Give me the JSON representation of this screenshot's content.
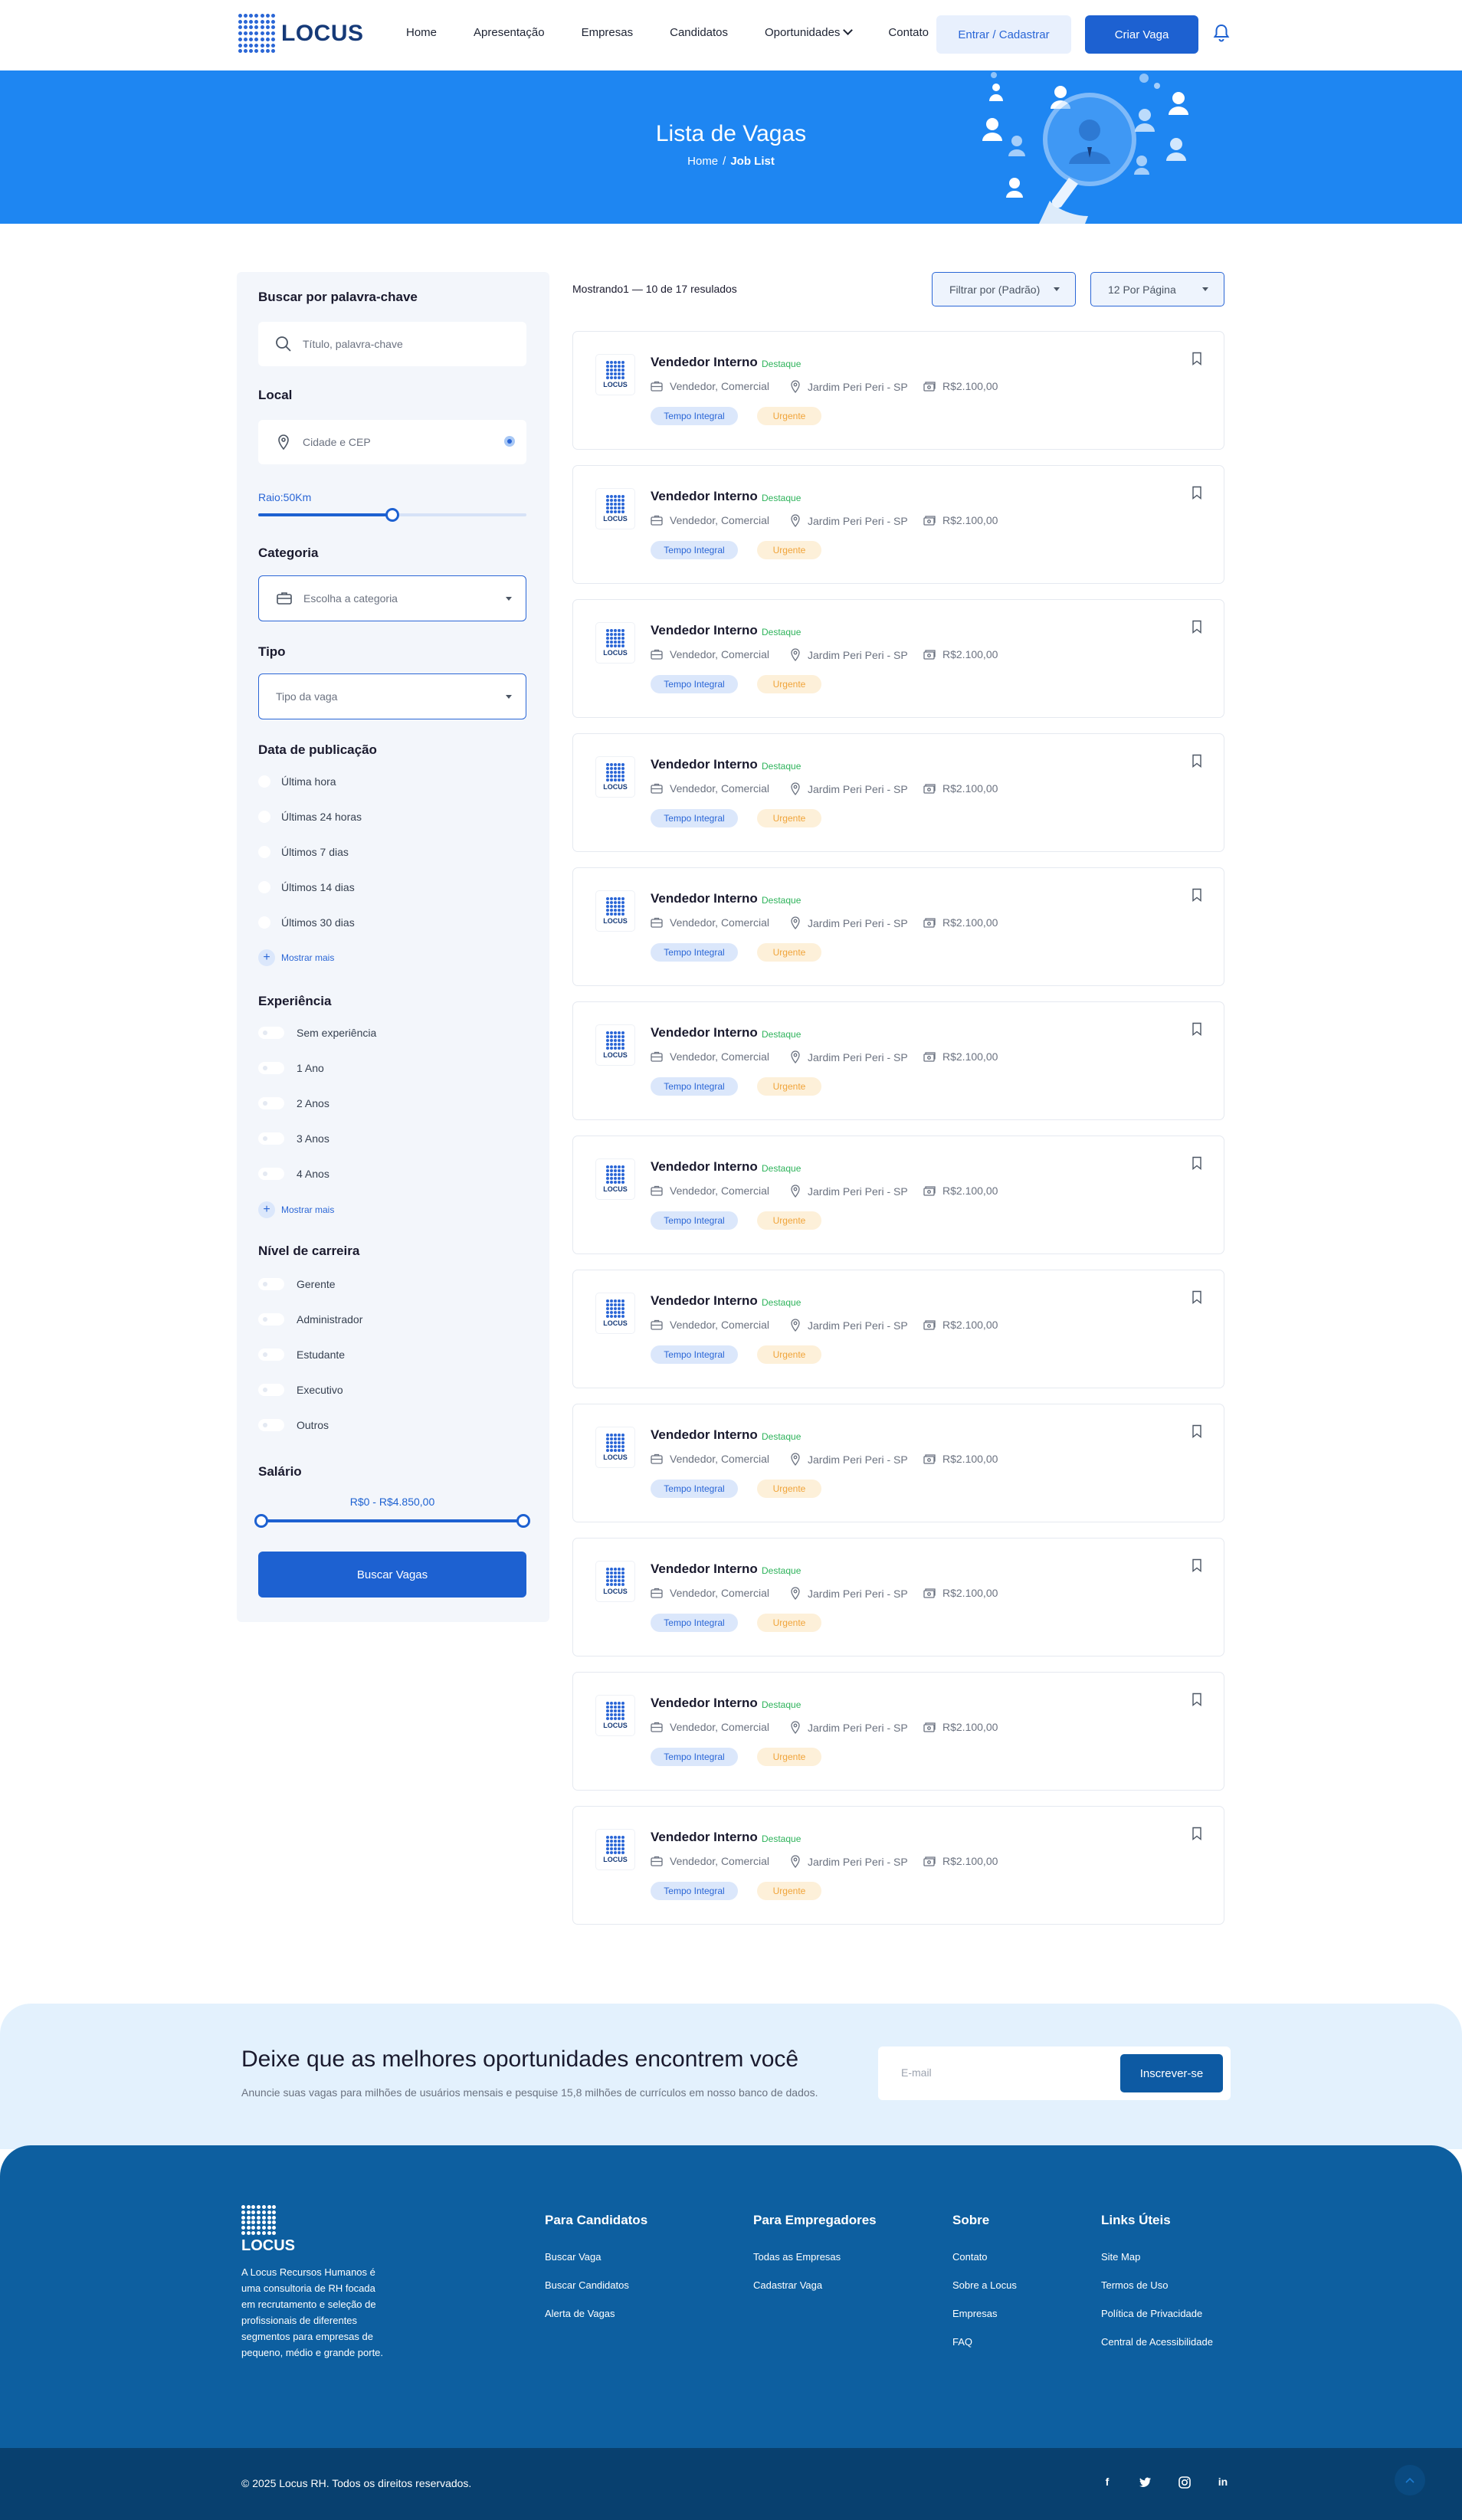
{
  "header": {
    "brand": "LOCUS",
    "nav": [
      "Home",
      "Apresentação",
      "Empresas",
      "Candidatos",
      "Oportunidades",
      "Contato"
    ],
    "login_label": "Entrar / Cadastrar",
    "create_label": "Criar Vaga",
    "bell_icon": "bell-icon"
  },
  "hero": {
    "title": "Lista de Vagas",
    "crumb_home": "Home",
    "crumb_sep": "/",
    "crumb_current": "Job List"
  },
  "sidebar": {
    "keyword_heading": "Buscar por palavra-chave",
    "keyword_placeholder": "Título, palavra-chave",
    "location_heading": "Local",
    "location_placeholder": "Cidade e CEP",
    "radius_label": "Raio:50Km",
    "radius_value_km": 50,
    "radius_fraction": 0.5,
    "category_heading": "Categoria",
    "category_placeholder": "Escolha a categoria",
    "type_heading": "Tipo",
    "type_placeholder": "Tipo da vaga",
    "date_heading": "Data de publicação",
    "date_options": [
      "Última hora",
      "Últimas 24 horas",
      "Últimos 7 dias",
      "Últimos 14 dias",
      "Últimos 30 dias"
    ],
    "show_more": "Mostrar mais",
    "experience_heading": "Experiência",
    "experience_options": [
      "Sem experiência",
      "1 Ano",
      "2 Anos",
      "3 Anos",
      "4 Anos"
    ],
    "career_heading": "Nível de carreira",
    "career_options": [
      "Gerente",
      "Administrador",
      "Estudante",
      "Executivo",
      "Outros"
    ],
    "salary_heading": "Salário",
    "salary_label": "R$0 - R$4.850,00",
    "search_button": "Buscar Vagas"
  },
  "listing": {
    "results_text": "Mostrando1 — 10 de 17 resulados",
    "sort_label": "Filtrar por (Padrão)",
    "per_page_label": "12 Por Página",
    "jobs": [
      {
        "title": "Vendedor Interno",
        "featured": "Destaque",
        "category": "Vendedor, Comercial",
        "location": "Jardim Peri Peri - SP",
        "salary": "R$2.100,00",
        "tag1": "Tempo Integral",
        "tag2": "Urgente",
        "logo_text": "LOCUS"
      },
      {
        "title": "Vendedor Interno",
        "featured": "Destaque",
        "category": "Vendedor, Comercial",
        "location": "Jardim Peri Peri - SP",
        "salary": "R$2.100,00",
        "tag1": "Tempo Integral",
        "tag2": "Urgente",
        "logo_text": "LOCUS"
      },
      {
        "title": "Vendedor Interno",
        "featured": "Destaque",
        "category": "Vendedor, Comercial",
        "location": "Jardim Peri Peri - SP",
        "salary": "R$2.100,00",
        "tag1": "Tempo Integral",
        "tag2": "Urgente",
        "logo_text": "LOCUS"
      },
      {
        "title": "Vendedor Interno",
        "featured": "Destaque",
        "category": "Vendedor, Comercial",
        "location": "Jardim Peri Peri - SP",
        "salary": "R$2.100,00",
        "tag1": "Tempo Integral",
        "tag2": "Urgente",
        "logo_text": "LOCUS"
      },
      {
        "title": "Vendedor Interno",
        "featured": "Destaque",
        "category": "Vendedor, Comercial",
        "location": "Jardim Peri Peri - SP",
        "salary": "R$2.100,00",
        "tag1": "Tempo Integral",
        "tag2": "Urgente",
        "logo_text": "LOCUS"
      },
      {
        "title": "Vendedor Interno",
        "featured": "Destaque",
        "category": "Vendedor, Comercial",
        "location": "Jardim Peri Peri - SP",
        "salary": "R$2.100,00",
        "tag1": "Tempo Integral",
        "tag2": "Urgente",
        "logo_text": "LOCUS"
      },
      {
        "title": "Vendedor Interno",
        "featured": "Destaque",
        "category": "Vendedor, Comercial",
        "location": "Jardim Peri Peri - SP",
        "salary": "R$2.100,00",
        "tag1": "Tempo Integral",
        "tag2": "Urgente",
        "logo_text": "LOCUS"
      },
      {
        "title": "Vendedor Interno",
        "featured": "Destaque",
        "category": "Vendedor, Comercial",
        "location": "Jardim Peri Peri - SP",
        "salary": "R$2.100,00",
        "tag1": "Tempo Integral",
        "tag2": "Urgente",
        "logo_text": "LOCUS"
      },
      {
        "title": "Vendedor Interno",
        "featured": "Destaque",
        "category": "Vendedor, Comercial",
        "location": "Jardim Peri Peri - SP",
        "salary": "R$2.100,00",
        "tag1": "Tempo Integral",
        "tag2": "Urgente",
        "logo_text": "LOCUS"
      },
      {
        "title": "Vendedor Interno",
        "featured": "Destaque",
        "category": "Vendedor, Comercial",
        "location": "Jardim Peri Peri - SP",
        "salary": "R$2.100,00",
        "tag1": "Tempo Integral",
        "tag2": "Urgente",
        "logo_text": "LOCUS"
      },
      {
        "title": "Vendedor Interno",
        "featured": "Destaque",
        "category": "Vendedor, Comercial",
        "location": "Jardim Peri Peri - SP",
        "salary": "R$2.100,00",
        "tag1": "Tempo Integral",
        "tag2": "Urgente",
        "logo_text": "LOCUS"
      },
      {
        "title": "Vendedor Interno",
        "featured": "Destaque",
        "category": "Vendedor, Comercial",
        "location": "Jardim Peri Peri - SP",
        "salary": "R$2.100,00",
        "tag1": "Tempo Integral",
        "tag2": "Urgente",
        "logo_text": "LOCUS"
      }
    ]
  },
  "newsletter": {
    "title": "Deixe que as melhores oportunidades encontrem você",
    "subtitle": "Anuncie suas vagas para milhões de usuários mensais e pesquise 15,8 milhões de currículos em nosso banco de dados.",
    "email_placeholder": "E-mail",
    "button": "Inscrever-se"
  },
  "footer": {
    "brand": "LOCUS",
    "description": "A Locus Recursos Humanos é uma consultoria de RH focada em recrutamento e seleção de profissionais de diferentes segmentos para empresas de pequeno, médio e grande porte.",
    "columns": [
      {
        "title": "Para Candidatos",
        "links": [
          "Buscar Vaga",
          "Buscar Candidatos",
          "Alerta de Vagas"
        ]
      },
      {
        "title": "Para Empregadores",
        "links": [
          "Todas as Empresas",
          "Cadastrar Vaga"
        ]
      },
      {
        "title": "Sobre",
        "links": [
          "Contato",
          "Sobre a Locus",
          "Empresas",
          "FAQ"
        ]
      },
      {
        "title": "Links Úteis",
        "links": [
          "Site Map",
          "Termos de Uso",
          "Política de Privacidade",
          "Central de Acessibilidade"
        ]
      }
    ],
    "copyright": "© 2025 Locus RH. Todos os direitos reservados.",
    "social": {
      "facebook": "f",
      "linkedin": "in"
    }
  },
  "colors": {
    "primary": "#1d61d1",
    "hero": "#1e86f2",
    "footer": "#0d5fa0",
    "footer_bottom": "#08406f",
    "featured": "#2eb35b",
    "urgent": "#f0a43a"
  }
}
